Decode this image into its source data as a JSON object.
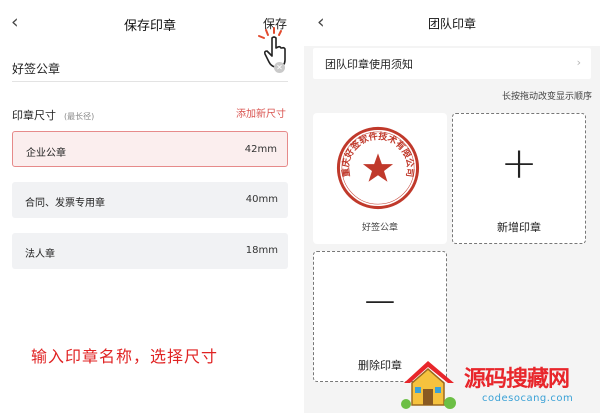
{
  "left": {
    "back_icon": "chevron-left",
    "title": "保存印章",
    "save_label": "保存",
    "seal_name_value": "好签公章",
    "size_label": "印章尺寸",
    "size_hint": "(最长径)",
    "add_size_label": "添加新尺寸",
    "options": [
      {
        "name": "企业公章",
        "size": "42mm",
        "selected": true
      },
      {
        "name": "合同、发票专用章",
        "size": "40mm",
        "selected": false
      },
      {
        "name": "法人章",
        "size": "18mm",
        "selected": false
      }
    ],
    "caption": "输入印章名称，选择尺寸"
  },
  "right": {
    "back_icon": "chevron-left",
    "title": "团队印章",
    "notice_label": "团队印章使用须知",
    "drag_hint": "长按拖动改变显示顺序",
    "seal_card_name": "好签公章",
    "stamp_text": "重庆好签软件技术有限公司",
    "add_label": "新增印章",
    "delete_label": "删除印章"
  },
  "watermark": {
    "title": "源码搜藏网",
    "url": "codesocang.com"
  },
  "colors": {
    "accent_red": "#d9534f",
    "selected_bg": "#fbeeee",
    "stamp_red": "#c0392b",
    "caption_red": "#e02323"
  }
}
